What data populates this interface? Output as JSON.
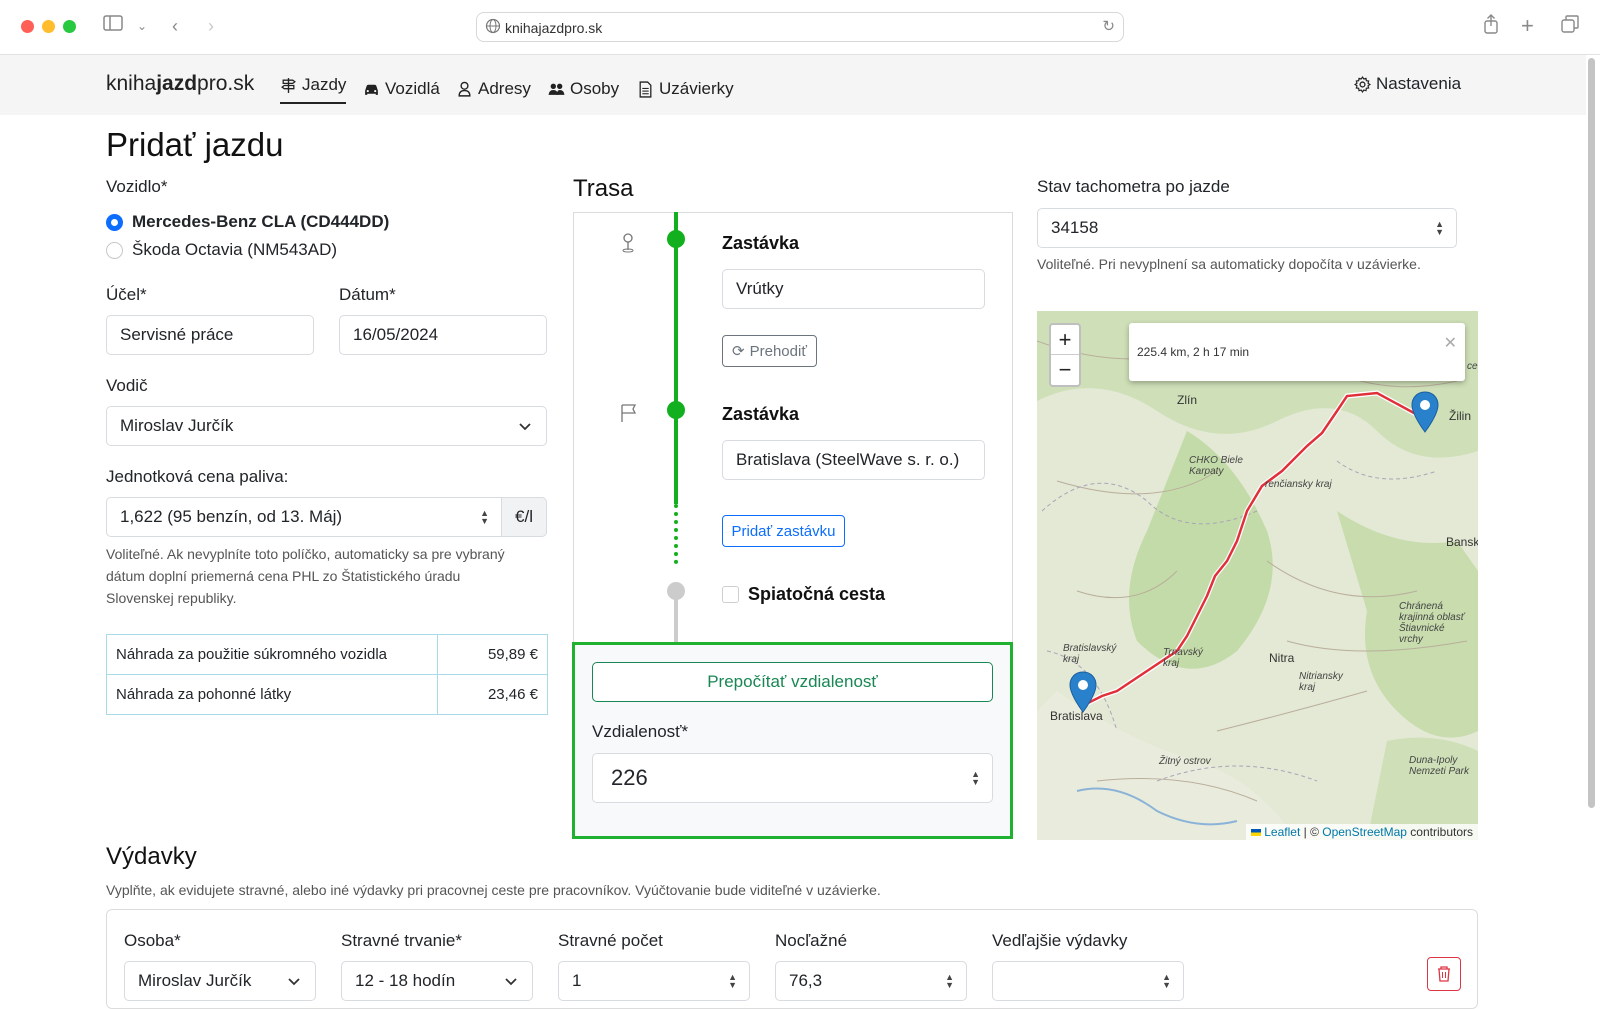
{
  "browser": {
    "url": "knihajazdpro.sk"
  },
  "navbar": {
    "brand_pre": "kniha",
    "brand_bold": "jazd",
    "brand_post": "pro.sk",
    "items": [
      {
        "label": "Jazdy",
        "icon": "signpost-icon"
      },
      {
        "label": "Vozidlá",
        "icon": "car-icon"
      },
      {
        "label": "Adresy",
        "icon": "map-pin-person-icon"
      },
      {
        "label": "Osoby",
        "icon": "people-icon"
      },
      {
        "label": "Uzávierky",
        "icon": "document-icon"
      }
    ],
    "active": "Jazdy",
    "settings_label": "Nastavenia"
  },
  "page": {
    "title": "Pridať jazdu"
  },
  "vehicle": {
    "label": "Vozidlo*",
    "options": [
      {
        "label": "Mercedes-Benz CLA (CD444DD)",
        "checked": true
      },
      {
        "label": "Škoda Octavia (NM543AD)",
        "checked": false
      }
    ]
  },
  "purpose": {
    "label": "Účel*",
    "value": "Servisné práce"
  },
  "date": {
    "label": "Dátum*",
    "value": "16/05/2024"
  },
  "driver": {
    "label": "Vodič",
    "value": "Miroslav Jurčík"
  },
  "fuel_price": {
    "label": "Jednotková cena paliva:",
    "value": "1,622 (95 benzín, od 13. Máj)",
    "unit": "€/l",
    "help_1": "Voliteľné. Ak nevyplníte toto políčko, automaticky sa pre vybraný",
    "help_2": "dátum doplní priemerná cena PHL zo Štatistického úradu",
    "help_3": "Slovenskej republiky."
  },
  "summary": [
    {
      "label": "Náhrada za použitie súkromného vozidla",
      "value": "59,89 €"
    },
    {
      "label": "Náhrada za pohonné látky",
      "value": "23,46 €"
    }
  ],
  "route": {
    "title": "Trasa",
    "stops": [
      {
        "title": "Zastávka",
        "value": "Vrútky"
      },
      {
        "title": "Zastávka",
        "value": "Bratislava (SteelWave s. r. o.)"
      }
    ],
    "swap_button": "Prehodiť",
    "add_stop_button": "Pridať zastávku",
    "round_trip_label": "Spiatočná cesta",
    "recalc_button": "Prepočítať vzdialenosť",
    "distance_label": "Vzdialenosť*",
    "distance_value": "226"
  },
  "odometer": {
    "label": "Stav tachometra po jazde",
    "value": "34158",
    "help": "Voliteľné. Pri nevyplnení sa automaticky dopočíta v uzávierke."
  },
  "map": {
    "popup_text": "225.4 km, 2 h 17 min",
    "zoom_in": "+",
    "zoom_out": "−",
    "attrib_leaflet": "Leaflet",
    "attrib_sep": " | © ",
    "attrib_osm": "OpenStreetMap",
    "attrib_contrib": " contributors",
    "labels": {
      "zlin": "Zlín",
      "zilin": "Žilin",
      "chko": "CHKO Biele Karpaty",
      "trencin": "renčiansky kraj",
      "banska": "Banská",
      "bratislavsky": "Bratislavský kraj",
      "trnavsky": "Trnavský kraj",
      "nitra": "Nitra",
      "nitriansky": "Nitriansky kraj",
      "chranena": "Chránená krajinná oblasť Štiavnické vrchy",
      "zitny": "Žitný ostrov",
      "bratislava": "Bratislava",
      "duna": "Duna-Ipoly Nemzeti Park",
      "ce": "ce"
    }
  },
  "expenses": {
    "title": "Výdavky",
    "help": "Vyplňte, ak evidujete stravné, alebo iné výdavky pri pracovnej ceste pre pracovníkov. Vyúčtovanie bude viditeľné v uzávierke.",
    "columns": [
      {
        "label": "Osoba*",
        "value": "Miroslav Jurčík"
      },
      {
        "label": "Stravné trvanie*",
        "value": "12 - 18 hodín"
      },
      {
        "label": "Stravné počet",
        "value": "1"
      },
      {
        "label": "Nocľažné",
        "value": "76,3"
      },
      {
        "label": "Vedľajšie výdavky",
        "value": ""
      }
    ]
  },
  "colors": {
    "accent": "#0d6efd",
    "route_green": "#12b01e",
    "highlight_green": "#1fb12f",
    "danger": "#dc3545"
  }
}
